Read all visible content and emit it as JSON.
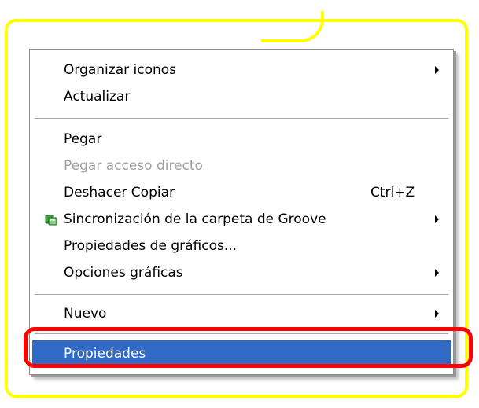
{
  "menu": {
    "items": [
      {
        "label": "Organizar iconos",
        "shortcut": "",
        "submenu": true,
        "disabled": false,
        "highlighted": false
      },
      {
        "label": "Actualizar",
        "shortcut": "",
        "submenu": false,
        "disabled": false,
        "highlighted": false
      },
      {
        "label": "Pegar",
        "shortcut": "",
        "submenu": false,
        "disabled": false,
        "highlighted": false
      },
      {
        "label": "Pegar acceso directo",
        "shortcut": "",
        "submenu": false,
        "disabled": true,
        "highlighted": false
      },
      {
        "label": "Deshacer Copiar",
        "shortcut": "Ctrl+Z",
        "submenu": false,
        "disabled": false,
        "highlighted": false
      },
      {
        "label": "Sincronización de la carpeta de Groove",
        "shortcut": "",
        "submenu": true,
        "disabled": false,
        "highlighted": false,
        "icon": "groove-sync-icon"
      },
      {
        "label": "Propiedades de gráficos...",
        "shortcut": "",
        "submenu": false,
        "disabled": false,
        "highlighted": false
      },
      {
        "label": "Opciones gráficas",
        "shortcut": "",
        "submenu": true,
        "disabled": false,
        "highlighted": false
      },
      {
        "label": "Nuevo",
        "shortcut": "",
        "submenu": true,
        "disabled": false,
        "highlighted": false
      },
      {
        "label": "Propiedades",
        "shortcut": "",
        "submenu": false,
        "disabled": false,
        "highlighted": true
      }
    ]
  },
  "colors": {
    "highlight": "#316ac5",
    "callout": "#ffff00",
    "annotation": "#ff0000",
    "disabled_text": "#a0a0a0"
  }
}
